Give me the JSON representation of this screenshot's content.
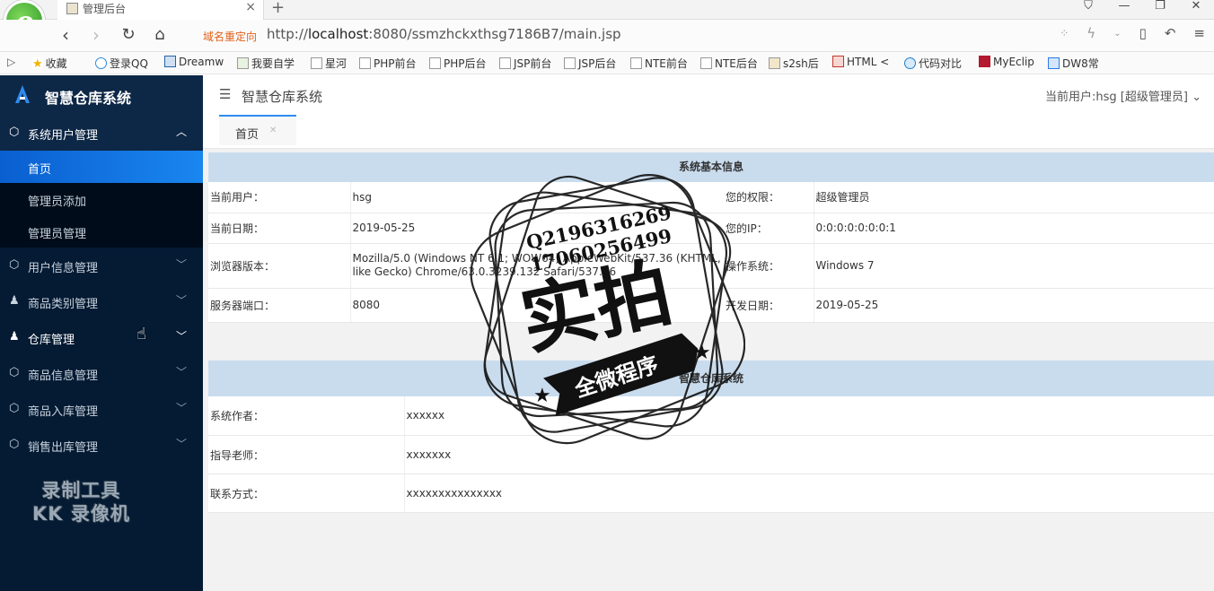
{
  "browser": {
    "tab_title": "管理后台",
    "tab_close": "×",
    "new_tab": "+",
    "redirect_label": "域名重定向",
    "url_prefix": "http://",
    "url_host": "localhost",
    "url_rest": ":8080/ssmzhckxthsg7186B7/main.jsp",
    "bookmarks": [
      "收藏",
      "登录QQ",
      "Dreamw",
      "我要自学",
      "星河",
      "PHP前台",
      "PHP后台",
      "JSP前台",
      "JSP后台",
      "NTE前台",
      "NTE后台",
      "s2sh后",
      "HTML <",
      "代码对比",
      "MyEclip",
      "DW8常"
    ]
  },
  "sidebar": {
    "title": "智慧仓库系统",
    "menus": [
      {
        "label": "系统用户管理",
        "open": true,
        "subitems": [
          "首页",
          "管理员添加",
          "管理员管理"
        ]
      },
      {
        "label": "用户信息管理"
      },
      {
        "label": "商品类别管理"
      },
      {
        "label": "仓库管理"
      },
      {
        "label": "商品信息管理"
      },
      {
        "label": "商品入库管理"
      },
      {
        "label": "销售出库管理"
      }
    ],
    "watermark_line1": "录制工具",
    "watermark_line2": "KK 录像机"
  },
  "header": {
    "title": "智慧仓库系统",
    "current_user": "当前用户:hsg [超级管理员]"
  },
  "tabs": [
    {
      "label": "首页",
      "close": "✕"
    }
  ],
  "system_info": {
    "title": "系统基本信息",
    "rows": [
      {
        "k1": "当前用户：",
        "v1": "hsg",
        "k2": "您的权限：",
        "v2": "超级管理员"
      },
      {
        "k1": "当前日期：",
        "v1": "2019-05-25",
        "k2": "您的IP：",
        "v2": "0:0:0:0:0:0:0:1"
      },
      {
        "k1": "浏览器版本：",
        "v1": "Mozilla/5.0 (Windows NT 6.1; WOW64) AppleWebKit/537.36 (KHTML, like Gecko) Chrome/63.0.3239.132 Safari/537.36",
        "k2": "操作系统：",
        "v2": "Windows 7"
      },
      {
        "k1": "服务器端口：",
        "v1": "8080",
        "k2": "开发日期：",
        "v2": "2019-05-25"
      }
    ]
  },
  "system_about": {
    "title": "智慧仓库系统",
    "rows": [
      {
        "k": "系统作者：",
        "v": "xxxxxx"
      },
      {
        "k": "指导老师：",
        "v": "xxxxxxx"
      },
      {
        "k": "联系方式：",
        "v": "xxxxxxxxxxxxxxx"
      }
    ]
  },
  "stamp": {
    "phone1": "Q2196316269",
    "phone2": "17060256499",
    "big_text": "实拍",
    "banner": "全微程序"
  }
}
